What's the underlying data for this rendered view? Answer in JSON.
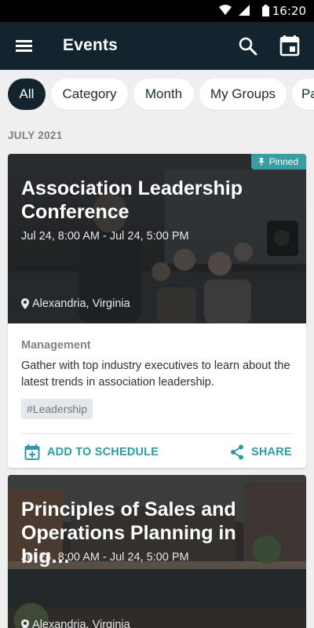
{
  "status": {
    "time": "16:20"
  },
  "appbar": {
    "title": "Events"
  },
  "chips": [
    "All",
    "Category",
    "Month",
    "My Groups",
    "Pa"
  ],
  "section": "JULY 2021",
  "events": [
    {
      "title": "Association Leadership Conference",
      "datetime": "Jul 24, 8:00 AM - Jul 24, 5:00 PM",
      "location": "Alexandria, Virginia",
      "pinned_label": "Pinned",
      "category": "Management",
      "description": "Gather with top industry executives to learn about the latest trends in association leadership.",
      "tag": "#Leadership",
      "add_label": "ADD TO SCHEDULE",
      "share_label": "SHARE"
    },
    {
      "title": "Principles of Sales and Operations Planning in big…",
      "datetime": "Jul 24, 8:00 AM - Jul 24, 5:00 PM",
      "location": "Alexandria, Virginia"
    }
  ],
  "colors": {
    "appbar": "#13242f",
    "accent": "#2f9aa3",
    "pinned": "#3a9ca4"
  }
}
